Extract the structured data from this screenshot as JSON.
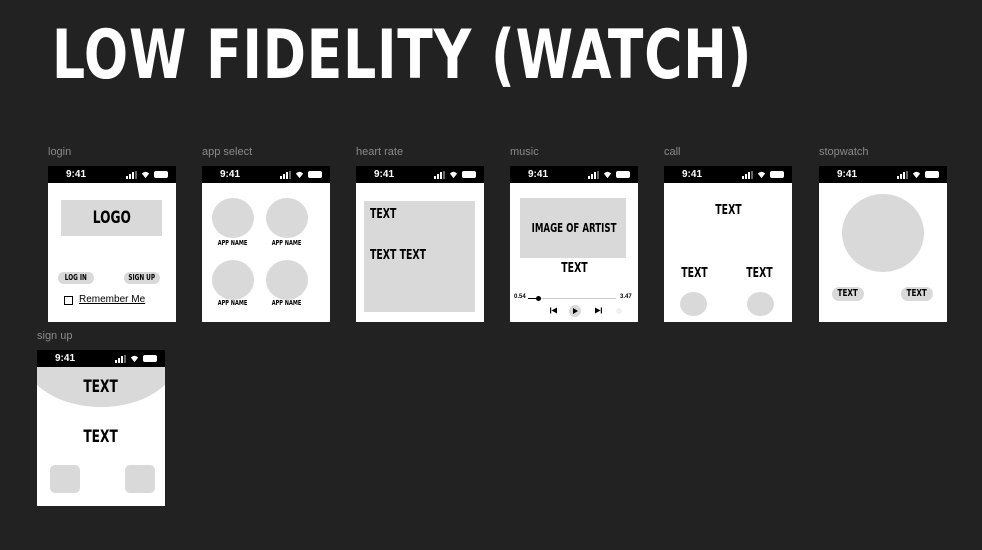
{
  "page": {
    "title": "LOW FIDELITY (WATCH)"
  },
  "status": {
    "time": "9:41"
  },
  "login": {
    "label": "login",
    "logo": "LOGO",
    "login_btn": "LOG IN",
    "signup_btn": "SIGN UP",
    "remember": "Remember Me"
  },
  "app_select": {
    "label": "app select",
    "apps": [
      "APP NAME",
      "APP NAME",
      "APP NAME",
      "APP NAME"
    ]
  },
  "heart_rate": {
    "label": "heart rate",
    "text1": "TEXT",
    "text2": "TEXT TEXT"
  },
  "music": {
    "label": "music",
    "artist": "IMAGE OF ARTIST",
    "text": "TEXT",
    "elapsed": "0.54",
    "total": "3.47",
    "progress": 0.12
  },
  "call": {
    "label": "call",
    "top": "TEXT",
    "left": "TEXT",
    "right": "TEXT"
  },
  "stopwatch": {
    "label": "stopwatch",
    "left_btn": "TEXT",
    "right_btn": "TEXT"
  },
  "sign_up": {
    "label": "sign up",
    "text1": "TEXT",
    "text2": "TEXT"
  }
}
